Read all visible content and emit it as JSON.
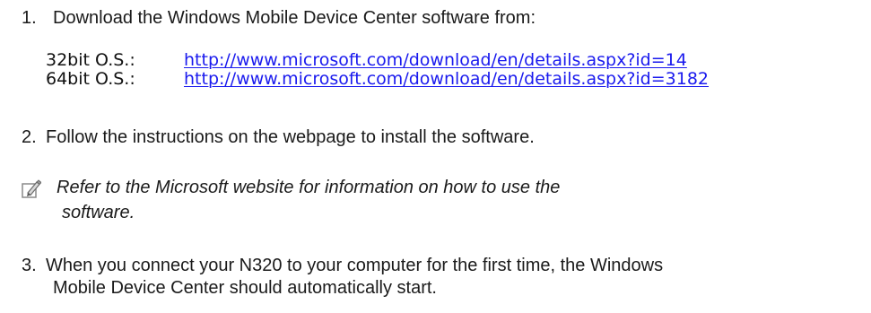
{
  "steps": [
    {
      "number": "1.",
      "text": "Download the Windows Mobile Device Center software from:"
    },
    {
      "number": "2.",
      "text": "Follow the instructions on the webpage to install the software."
    },
    {
      "number": "3.",
      "lines": [
        "When you connect your N320 to your computer for the first time, the Windows",
        "Mobile Device Center should automatically start."
      ]
    }
  ],
  "downloads": [
    {
      "os": "32bit O.S.:",
      "url": "http://www.microsoft.com/download/en/details.aspx?id=14"
    },
    {
      "os": "64bit O.S.:",
      "url": "http://www.microsoft.com/download/en/details.aspx?id=3182"
    }
  ],
  "note": {
    "icon": "pencil-note-icon",
    "lines": [
      "Refer to the Microsoft website for information on how to use the",
      "software."
    ]
  }
}
